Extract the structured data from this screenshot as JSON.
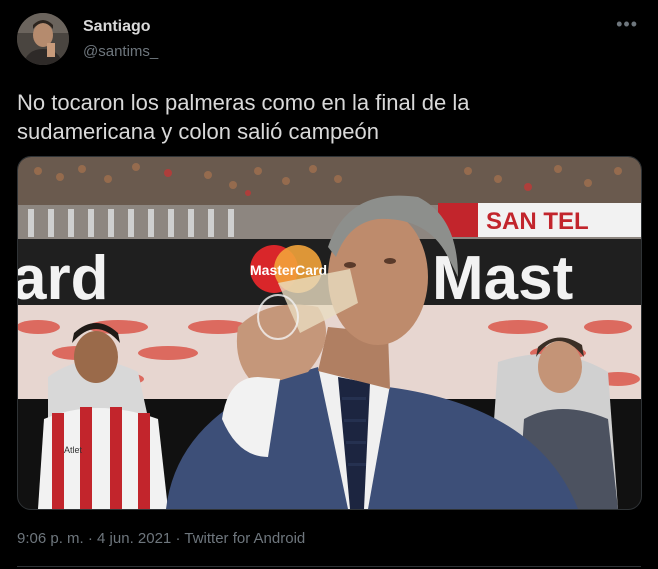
{
  "author": {
    "name": "Santiago",
    "handle": "@santims_"
  },
  "tweet": {
    "text_line1": "No tocaron los palmeras como en la final de la",
    "text_line2": "sudamericana y colon salió campeón",
    "time": "9:06 p. m.",
    "separator": "·",
    "date": "4 jun. 2021",
    "source": "Twitter for Android"
  },
  "photo": {
    "banner_left": "ard",
    "banner_logo": "MasterCard",
    "banner_right": "Mast",
    "banner_top": "SAN TEL",
    "jersey_text": "Atlet"
  },
  "icons": {
    "more": "more-horizontal-icon"
  },
  "colors": {
    "background": "#000000",
    "primary_text": "#d9d9d9",
    "secondary_text": "#6e767d",
    "border": "#2f3336"
  }
}
